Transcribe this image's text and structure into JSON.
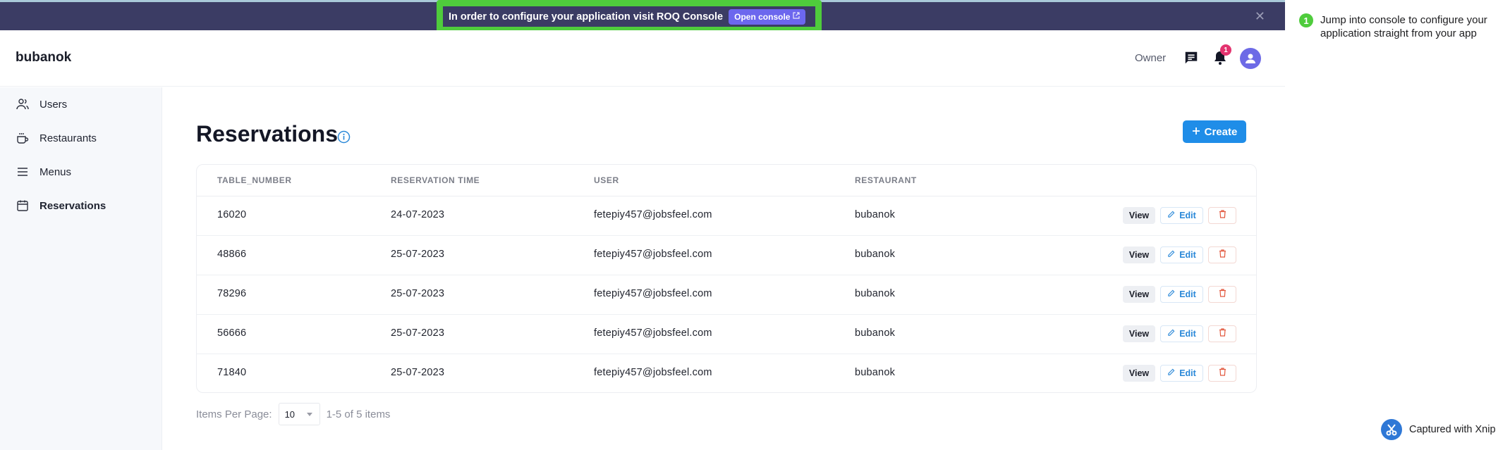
{
  "banner": {
    "message": "In order to configure your application visit ROQ Console",
    "open_console_label": "Open console",
    "close_icon": "close-icon",
    "step_number": "1"
  },
  "header": {
    "brand": "bubanok",
    "role": "Owner",
    "notification_count": "1",
    "icons": [
      "chat-icon",
      "bell-icon",
      "user-avatar-icon"
    ]
  },
  "sidebar": {
    "items": [
      {
        "label": "Users",
        "icon": "users-icon",
        "active": false
      },
      {
        "label": "Restaurants",
        "icon": "coffee-cup-icon",
        "active": false
      },
      {
        "label": "Menus",
        "icon": "menu-lines-icon",
        "active": false
      },
      {
        "label": "Reservations",
        "icon": "calendar-icon",
        "active": true
      }
    ]
  },
  "main": {
    "title": "Reservations",
    "create_label": "Create",
    "table": {
      "columns": [
        "TABLE_NUMBER",
        "RESERVATION TIME",
        "USER",
        "RESTAURANT"
      ],
      "rows": [
        {
          "table_number": "16020",
          "reservation_time": "24-07-2023",
          "user": "fetepiy457@jobsfeel.com",
          "restaurant": "bubanok"
        },
        {
          "table_number": "48866",
          "reservation_time": "25-07-2023",
          "user": "fetepiy457@jobsfeel.com",
          "restaurant": "bubanok"
        },
        {
          "table_number": "78296",
          "reservation_time": "25-07-2023",
          "user": "fetepiy457@jobsfeel.com",
          "restaurant": "bubanok"
        },
        {
          "table_number": "56666",
          "reservation_time": "25-07-2023",
          "user": "fetepiy457@jobsfeel.com",
          "restaurant": "bubanok"
        },
        {
          "table_number": "71840",
          "reservation_time": "25-07-2023",
          "user": "fetepiy457@jobsfeel.com",
          "restaurant": "bubanok"
        }
      ],
      "actions": {
        "view": "View",
        "edit": "Edit"
      }
    },
    "pagination": {
      "items_per_page_label": "Items Per Page:",
      "items_per_page_value": "10",
      "range_text": "1-5 of 5 items"
    }
  },
  "annotation": {
    "step_number": "1",
    "text": "Jump into console to configure your application straight from your app"
  },
  "watermark": {
    "text": "Captured with Xnip"
  },
  "colors": {
    "banner_bg": "#3b3c64",
    "callout_green": "#4fcc3c",
    "open_console_bg": "#6c67ee",
    "primary": "#1f8de8",
    "notification": "#e3336f",
    "avatar": "#6d6ae6",
    "delete": "#e2583e"
  }
}
